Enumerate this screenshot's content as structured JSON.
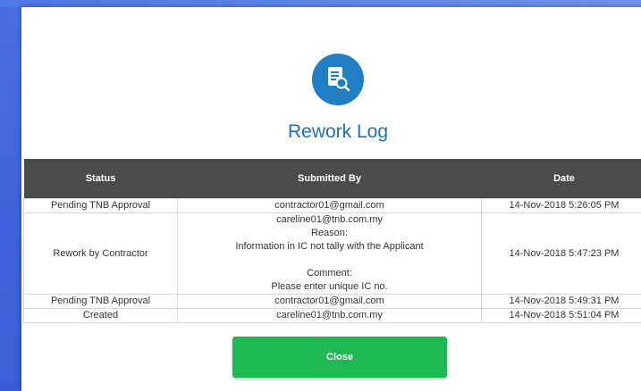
{
  "modal": {
    "title": "Rework Log",
    "close_icon": "close-icon",
    "header_icon": "document-search-icon",
    "accent_color": "#1d6fb8",
    "button_color": "#1fb954"
  },
  "table": {
    "headers": [
      "Status",
      "Submitted By",
      "Date"
    ],
    "rows": [
      {
        "status": "Pending TNB Approval",
        "submitted_by": [
          "contractor01@gmail.com"
        ],
        "date": "14-Nov-2018 5:26:05 PM"
      },
      {
        "status": "Rework by Contractor",
        "submitted_by": [
          "careline01@tnb.com.my",
          "Reason:",
          "Information in IC not tally with the Applicant",
          "",
          "Comment:",
          "Please enter unique IC no."
        ],
        "date": "14-Nov-2018 5:47:23 PM"
      },
      {
        "status": "Pending TNB Approval",
        "submitted_by": [
          "contractor01@gmail.com"
        ],
        "date": "14-Nov-2018 5:49:31 PM"
      },
      {
        "status": "Created",
        "submitted_by": [
          "careline01@tnb.com.my"
        ],
        "date": "14-Nov-2018 5:51:04 PM"
      }
    ]
  },
  "footer": {
    "close_label": "Close"
  }
}
